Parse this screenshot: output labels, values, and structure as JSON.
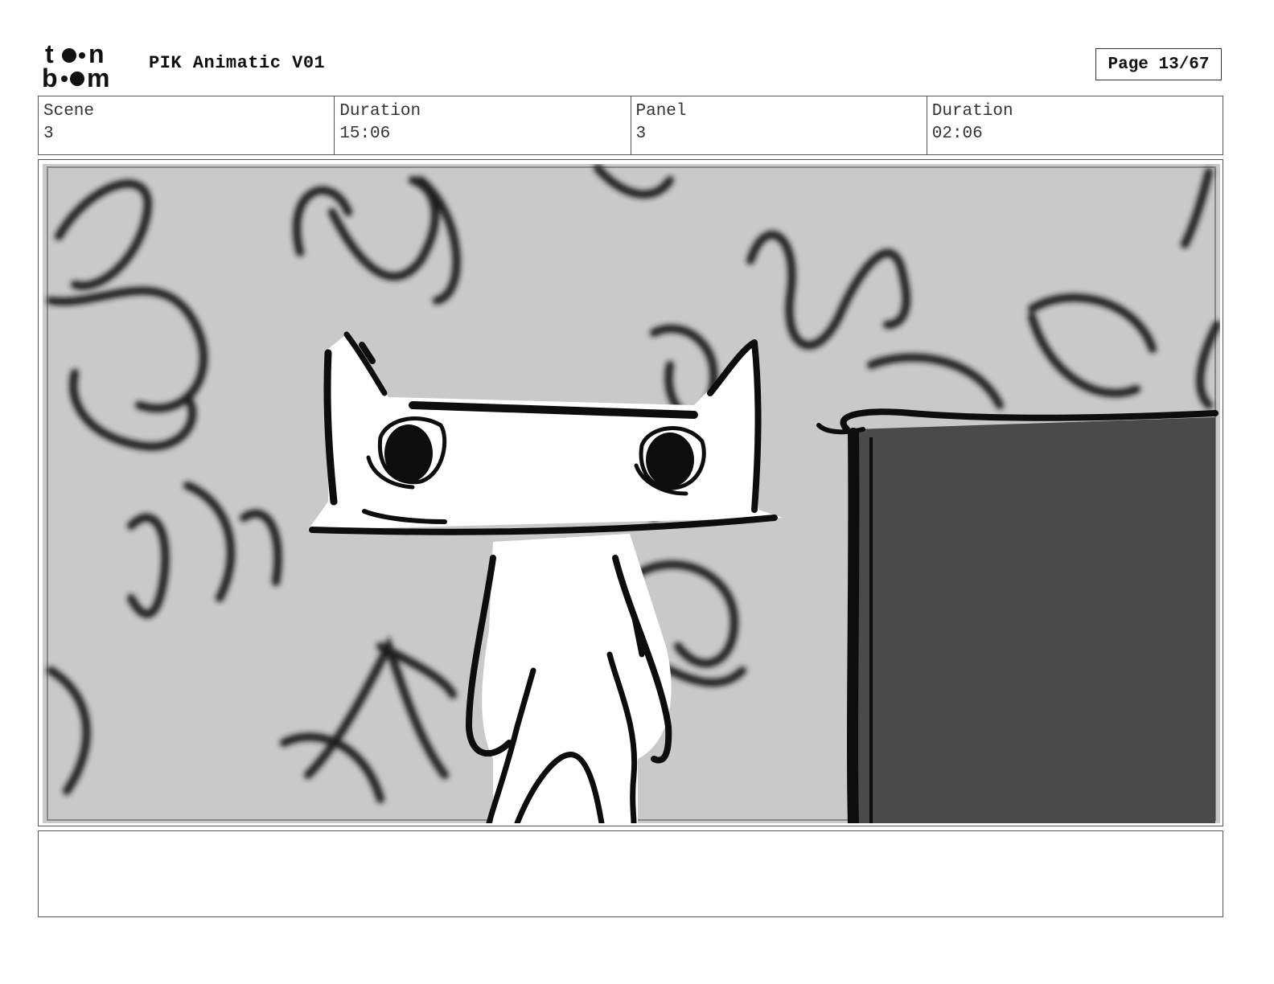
{
  "header": {
    "logo_text_top": "toon",
    "logo_text_bottom": "boom",
    "title": "PIK Animatic V01",
    "page_label": "Page 13/67"
  },
  "info": {
    "scene_label": "Scene",
    "scene_value": "3",
    "scene_duration_label": "Duration",
    "scene_duration_value": "15:06",
    "panel_label": "Panel",
    "panel_value": "3",
    "panel_duration_label": "Duration",
    "panel_duration_value": "02:06"
  },
  "panel": {
    "background_color": "#c9c9c9",
    "block_color": "#4a4a4a",
    "ink_color": "#111111"
  },
  "notes": {
    "text": ""
  }
}
